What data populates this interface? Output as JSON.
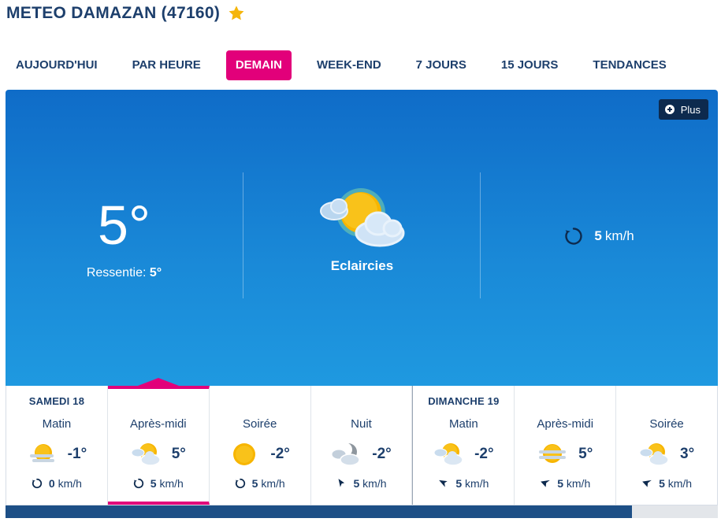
{
  "header": {
    "title": "METEO DAMAZAN (47160)",
    "favorite_icon": "star-icon"
  },
  "tabs": [
    {
      "label": "AUJOURD'HUI",
      "active": false
    },
    {
      "label": "PAR HEURE",
      "active": false
    },
    {
      "label": "DEMAIN",
      "active": true
    },
    {
      "label": "WEEK-END",
      "active": false
    },
    {
      "label": "7 JOURS",
      "active": false
    },
    {
      "label": "15 JOURS",
      "active": false
    },
    {
      "label": "TENDANCES",
      "active": false
    }
  ],
  "hero": {
    "plus_label": "Plus",
    "temperature": "5°",
    "feels_like_label": "Ressentie:",
    "feels_like_value": "5°",
    "condition_icon": "sun-cloud-icon",
    "condition": "Eclaircies",
    "wind_value": "5",
    "wind_unit": "km/h",
    "wind_icon": "variable-wind-icon"
  },
  "periods": [
    {
      "day": "SAMEDI 18",
      "label": "Matin",
      "temp": "-1°",
      "wind": "0",
      "unit": "km/h",
      "icon": "fog-sun-icon",
      "wind_icon": "variable-wind-icon"
    },
    {
      "day": "",
      "label": "Après-midi",
      "temp": "5°",
      "wind": "5",
      "unit": "km/h",
      "icon": "sun-cloud-icon",
      "wind_icon": "variable-wind-icon"
    },
    {
      "day": "",
      "label": "Soirée",
      "temp": "-2°",
      "wind": "5",
      "unit": "km/h",
      "icon": "sun-icon",
      "wind_icon": "variable-wind-icon"
    },
    {
      "day": "",
      "label": "Nuit",
      "temp": "-2°",
      "wind": "5",
      "unit": "km/h",
      "icon": "moon-cloud-icon",
      "wind_icon": "wind-direction-arrow-icon"
    },
    {
      "day": "DIMANCHE 19",
      "label": "Matin",
      "temp": "-2°",
      "wind": "5",
      "unit": "km/h",
      "icon": "sun-cloud-icon",
      "wind_icon": "wind-direction-arrow-icon"
    },
    {
      "day": "",
      "label": "Après-midi",
      "temp": "5°",
      "wind": "5",
      "unit": "km/h",
      "icon": "fog-sun-icon",
      "wind_icon": "wind-direction-arrow-icon"
    },
    {
      "day": "",
      "label": "Soirée",
      "temp": "3°",
      "wind": "5",
      "unit": "km/h",
      "icon": "sun-cloud-icon",
      "wind_icon": "wind-direction-arrow-icon"
    }
  ],
  "colors": {
    "accent": "#e2007a",
    "navy": "#1d3f6c",
    "sky_top": "#0f6cc8",
    "sky_bottom": "#1f99e0",
    "sun": "#f7b500"
  }
}
